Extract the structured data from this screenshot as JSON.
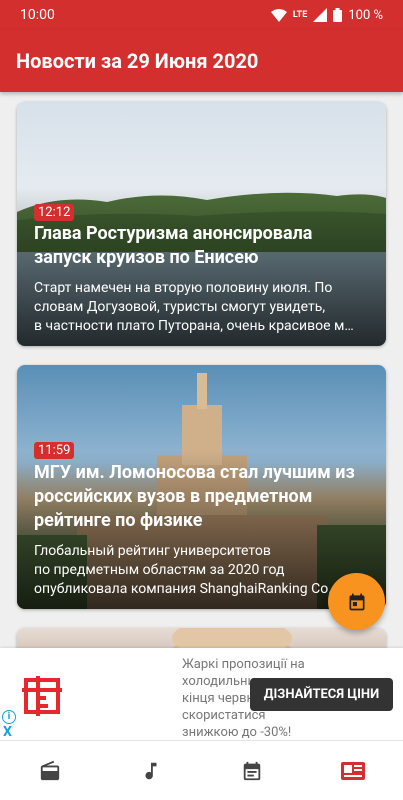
{
  "status": {
    "time": "10:00",
    "network": "LTE",
    "battery": "100 %"
  },
  "appbar": {
    "title": "Новости за 29 Июня 2020"
  },
  "articles": [
    {
      "time": "12:12",
      "title": "Глава Ростуризма анонсировала запуск круизов по Енисею",
      "desc_lines": [
        "Старт намечен на вторую половину июля. По",
        "словам Догузовой, туристы смогут увидеть,",
        "в частности плато Путорана, очень красивое м…"
      ]
    },
    {
      "time": "11:59",
      "title": "МГУ им. Ломоносова стал лучшим из российских вузов в предметном рейтинге по физике",
      "desc_lines": [
        "Глобальный рейтинг университетов",
        "по предметным областям за 2020 год",
        "опубликовала компания ShanghaiRanking Co…"
      ]
    }
  ],
  "ad": {
    "text_lines": [
      "Жаркі пропозиції на",
      "холодильники до",
      "кінця червня — для",
      "скористатися",
      "знижкою до -30%!"
    ],
    "cta": "ДІЗНАЙТЕСЯ ЦІНИ",
    "info": "i",
    "close": "X"
  },
  "colors": {
    "primary": "#d32f2f",
    "fab": "#f7931e",
    "nav_active": "#d32f2f",
    "nav_inactive": "#444444"
  },
  "nav": [
    {
      "icon": "radio-icon",
      "active": false
    },
    {
      "icon": "music-note-icon",
      "active": false
    },
    {
      "icon": "calendar-icon",
      "active": false
    },
    {
      "icon": "newspaper-icon",
      "active": true
    }
  ]
}
